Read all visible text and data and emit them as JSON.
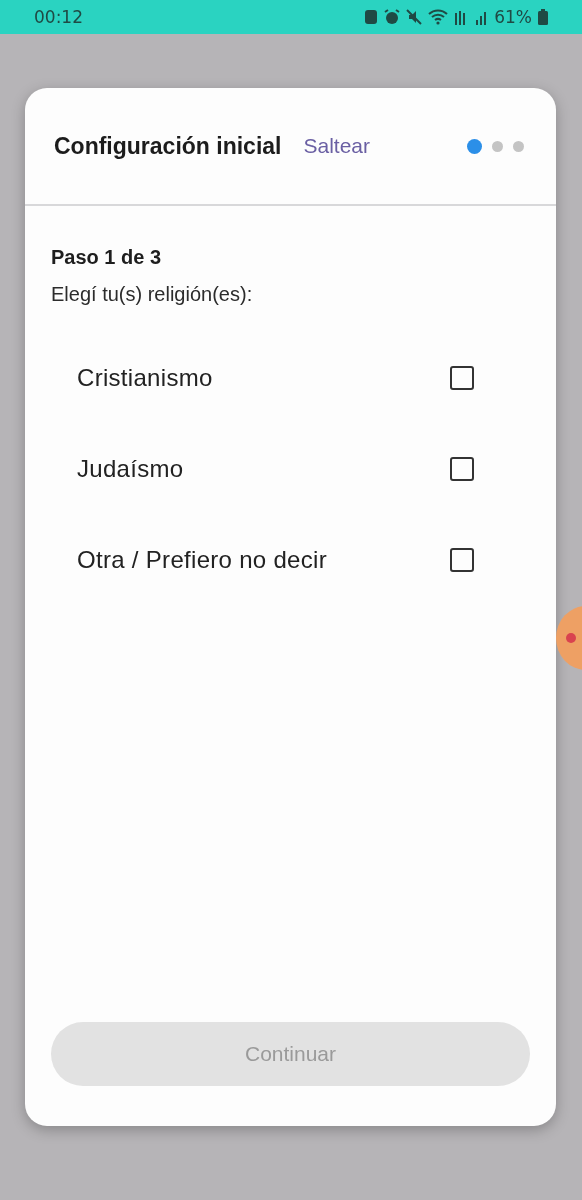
{
  "status_bar": {
    "time": "00:12",
    "battery": "61%"
  },
  "dialog": {
    "title": "Configuración inicial",
    "skip": "Saltear",
    "pages": [
      {
        "selected": true
      },
      {
        "selected": false
      },
      {
        "selected": false
      }
    ],
    "step": "Paso 1 de 3",
    "prompt": "Elegí tu(s) religión(es):",
    "options": [
      {
        "label": "Cristianismo",
        "checked": false
      },
      {
        "label": "Judaísmo",
        "checked": false
      },
      {
        "label": "Otra / Prefiero no decir",
        "checked": false
      }
    ],
    "continue_button": {
      "label": "Continuar",
      "disabled": true
    }
  }
}
